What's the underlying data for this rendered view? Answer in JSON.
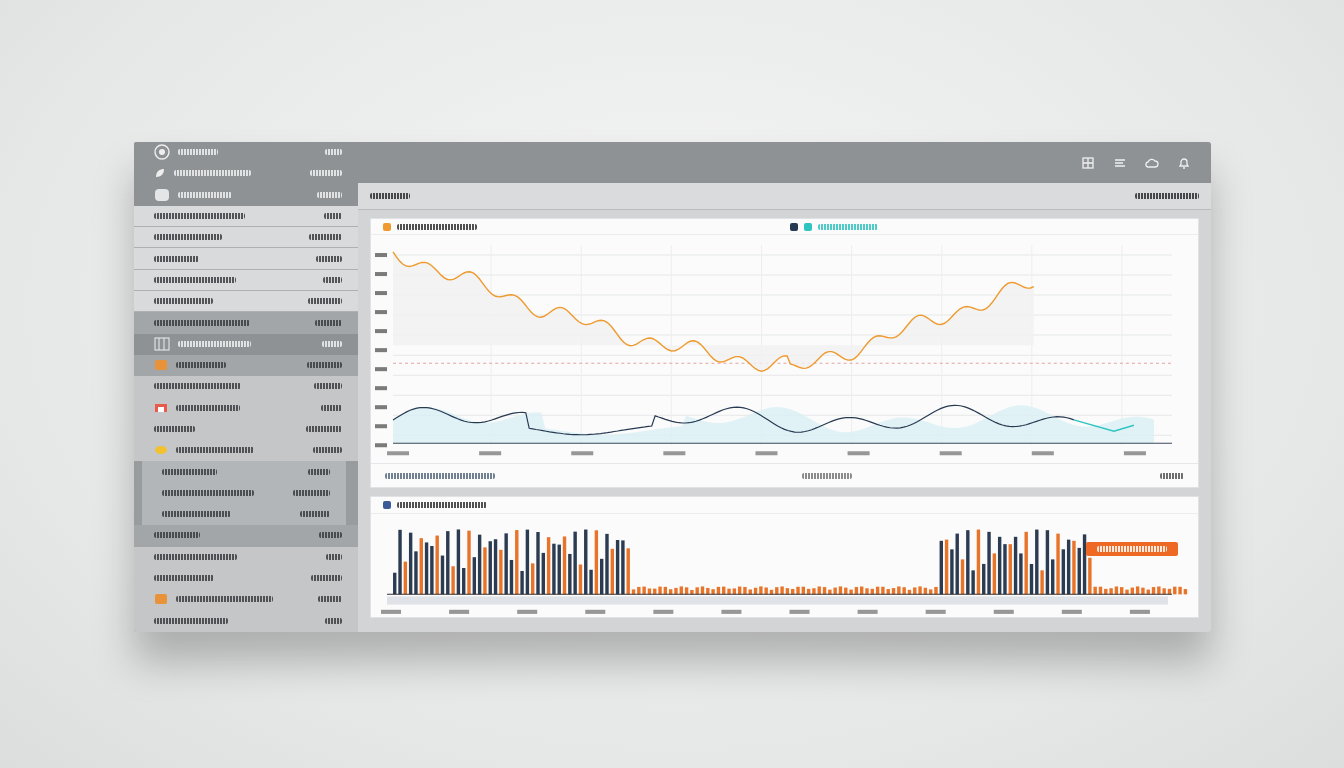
{
  "toolbar_icons": [
    {
      "kind": "grid"
    },
    {
      "kind": "lines"
    },
    {
      "kind": "cloud"
    },
    {
      "kind": "bell"
    }
  ],
  "sidebar": {
    "rows": [
      {
        "kind": "dark"
      },
      {
        "kind": "dark"
      },
      {
        "kind": "dark"
      },
      {
        "kind": "light"
      },
      {
        "kind": "light"
      },
      {
        "kind": "light"
      },
      {
        "kind": "light"
      },
      {
        "kind": "light"
      },
      {
        "kind": "mid"
      },
      {
        "kind": "dark"
      },
      {
        "kind": "mid"
      },
      {
        "kind": "plain"
      },
      {
        "kind": "plain"
      },
      {
        "kind": "plain"
      },
      {
        "kind": "plain"
      },
      {
        "kind": "inset"
      },
      {
        "kind": "inset"
      },
      {
        "kind": "inset"
      },
      {
        "kind": "mid"
      },
      {
        "kind": "plain"
      },
      {
        "kind": "plain"
      },
      {
        "kind": "plain"
      },
      {
        "kind": "plain"
      }
    ]
  },
  "line_panel": {
    "series": [
      {
        "color": "#ee9a2e"
      },
      {
        "color": "#263a52"
      },
      {
        "color": "#2ec4c0"
      }
    ]
  }
}
